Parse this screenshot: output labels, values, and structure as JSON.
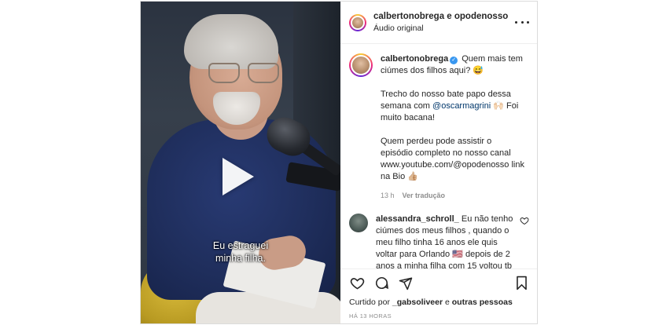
{
  "header": {
    "username": "calbertonobrega e opodenosso",
    "audio": "Áudio original",
    "more_icon": "more-horizontal-icon"
  },
  "media": {
    "caption": "Eu estraguei\nminha filha.",
    "play_icon": "play-icon"
  },
  "post_caption": {
    "username": "calbertonobrega",
    "verified_icon": "verified-badge-icon",
    "line1": "Quem mais tem ciúmes dos filhos aqui? 😅",
    "para2_pre": "Trecho do nosso bate papo dessa semana com ",
    "para2_mention": "@oscarmagrini",
    "para2_post": " 🙌🏻 Foi muito bacana!",
    "para3": "Quem perdeu pode assistir o episódio completo no nosso canal www.youtube.com/@opodenosso link na Bio 👍🏼",
    "time": "13 h",
    "translate": "Ver tradução"
  },
  "comment": {
    "username": "alessandra_schroll_",
    "text": "Eu não tenho ciúmes dos meus filhos , quando o meu filho tinha 16 anos ele quis voltar para Orlando 🇺🇸 depois de 2 anos a minha filha com 15 voltou tb , não se adaptaram na",
    "like_icon": "heart-outline-icon"
  },
  "actions": {
    "icons": [
      "heart-outline-icon",
      "comment-icon",
      "share-icon",
      "bookmark-icon"
    ]
  },
  "likes": {
    "prefix": "Curtido por ",
    "user": "_gabsoliveer",
    "suffix": " e ",
    "others": "outras pessoas"
  },
  "timestamp": "HÁ 13 HORAS",
  "colors": {
    "link": "#00376b",
    "verified": "#3897f0",
    "muted": "#8e8e8e",
    "text": "#262626"
  }
}
